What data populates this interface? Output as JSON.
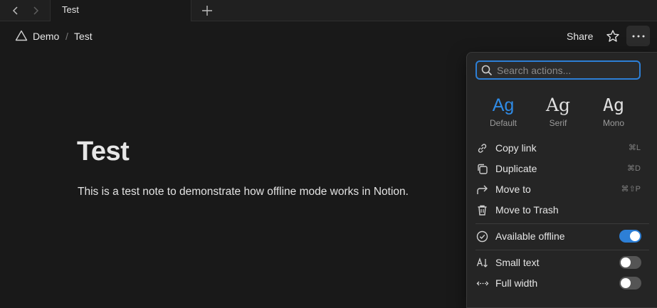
{
  "tabbar": {
    "tab_title": "Test",
    "icons": [
      "chevron-left-icon",
      "chevron-right-icon",
      "plus-icon"
    ]
  },
  "breadcrumb": {
    "workspace": "Demo",
    "separator": "/",
    "page": "Test"
  },
  "topbar": {
    "share_label": "Share"
  },
  "page": {
    "title": "Test",
    "body": "This is a test note to demonstrate how offline mode works in Notion."
  },
  "menu": {
    "search_placeholder": "Search actions...",
    "fonts": [
      {
        "sample": "Ag",
        "label": "Default",
        "selected": true
      },
      {
        "sample": "Ag",
        "label": "Serif",
        "selected": false
      },
      {
        "sample": "Ag",
        "label": "Mono",
        "selected": false
      }
    ],
    "actions": [
      {
        "label": "Copy link",
        "shortcut": "⌘L",
        "icon": "link-icon"
      },
      {
        "label": "Duplicate",
        "shortcut": "⌘D",
        "icon": "duplicate-icon"
      },
      {
        "label": "Move to",
        "shortcut": "⌘⇧P",
        "icon": "move-arrow-icon"
      },
      {
        "label": "Move to Trash",
        "shortcut": "",
        "icon": "trash-icon"
      }
    ],
    "offline": {
      "label": "Available offline",
      "enabled": true
    },
    "toggles": [
      {
        "label": "Small text",
        "enabled": false
      },
      {
        "label": "Full width",
        "enabled": false
      }
    ]
  },
  "colors": {
    "background": "#191919",
    "menu_background": "#252525",
    "accent": "#2d7fd6",
    "text": "#e6e6e6"
  }
}
